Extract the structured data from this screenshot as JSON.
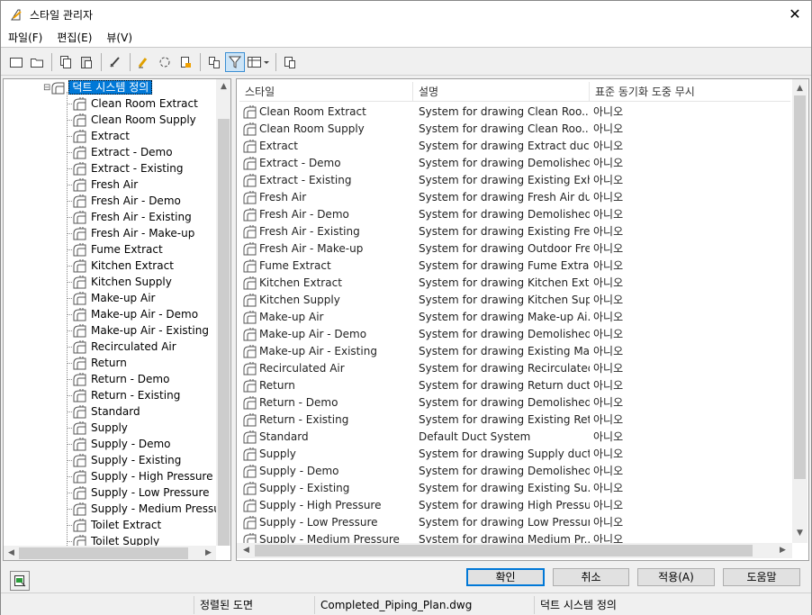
{
  "window": {
    "title": "스타일 관리자",
    "close_label": "✕"
  },
  "menu": [
    {
      "label": "파일(F)"
    },
    {
      "label": "편집(E)"
    },
    {
      "label": "뷰(V)"
    }
  ],
  "toolbar": {
    "active_tool": "filter-icon"
  },
  "tree": {
    "root_label": "덕트 시스템 정의",
    "items": [
      "Clean Room Extract",
      "Clean Room Supply",
      "Extract",
      "Extract - Demo",
      "Extract - Existing",
      "Fresh Air",
      "Fresh Air - Demo",
      "Fresh Air - Existing",
      "Fresh Air - Make-up",
      "Fume Extract",
      "Kitchen Extract",
      "Kitchen Supply",
      "Make-up Air",
      "Make-up Air - Demo",
      "Make-up Air - Existing",
      "Recirculated Air",
      "Return",
      "Return - Demo",
      "Return - Existing",
      "Standard",
      "Supply",
      "Supply - Demo",
      "Supply - Existing",
      "Supply - High Pressure",
      "Supply - Low Pressure",
      "Supply - Medium Pressu",
      "Toilet Extract",
      "Toilet Supply"
    ]
  },
  "list": {
    "columns": [
      "스타일",
      "설명",
      "표준 동기화 도중 무시"
    ],
    "rows": [
      {
        "style": "Clean Room Extract",
        "desc": "System for drawing Clean Roo...",
        "ignore": "아니오"
      },
      {
        "style": "Clean Room Supply",
        "desc": "System for drawing Clean Roo...",
        "ignore": "아니오"
      },
      {
        "style": "Extract",
        "desc": "System for drawing Extract duct.",
        "ignore": "아니오"
      },
      {
        "style": "Extract - Demo",
        "desc": "System for drawing Demolished...",
        "ignore": "아니오"
      },
      {
        "style": "Extract - Existing",
        "desc": "System for drawing Existing Exh...",
        "ignore": "아니오"
      },
      {
        "style": "Fresh Air",
        "desc": "System for drawing Fresh Air du...",
        "ignore": "아니오"
      },
      {
        "style": "Fresh Air - Demo",
        "desc": "System for drawing Demolished...",
        "ignore": "아니오"
      },
      {
        "style": "Fresh Air - Existing",
        "desc": "System for drawing Existing Fre...",
        "ignore": "아니오"
      },
      {
        "style": "Fresh Air - Make-up",
        "desc": "System for drawing Outdoor Fre...",
        "ignore": "아니오"
      },
      {
        "style": "Fume Extract",
        "desc": "System for drawing Fume Extra...",
        "ignore": "아니오"
      },
      {
        "style": "Kitchen Extract",
        "desc": "System for drawing Kitchen Extr...",
        "ignore": "아니오"
      },
      {
        "style": "Kitchen Supply",
        "desc": "System for drawing Kitchen Sup...",
        "ignore": "아니오"
      },
      {
        "style": "Make-up Air",
        "desc": "System for drawing Make-up Ai...",
        "ignore": "아니오"
      },
      {
        "style": "Make-up Air - Demo",
        "desc": "System for drawing Demolished...",
        "ignore": "아니오"
      },
      {
        "style": "Make-up Air - Existing",
        "desc": "System for drawing Existing Ma...",
        "ignore": "아니오"
      },
      {
        "style": "Recirculated Air",
        "desc": "System for drawing Recirculated...",
        "ignore": "아니오"
      },
      {
        "style": "Return",
        "desc": "System for drawing Return duct.",
        "ignore": "아니오"
      },
      {
        "style": "Return - Demo",
        "desc": "System for drawing Demolished...",
        "ignore": "아니오"
      },
      {
        "style": "Return - Existing",
        "desc": "System for drawing Existing Ret...",
        "ignore": "아니오"
      },
      {
        "style": "Standard",
        "desc": "Default Duct System",
        "ignore": "아니오"
      },
      {
        "style": "Supply",
        "desc": "System for drawing Supply duct.",
        "ignore": "아니오"
      },
      {
        "style": "Supply - Demo",
        "desc": "System for drawing Demolished...",
        "ignore": "아니오"
      },
      {
        "style": "Supply - Existing",
        "desc": "System for drawing Existing Su...",
        "ignore": "아니오"
      },
      {
        "style": "Supply - High Pressure",
        "desc": "System for drawing High Pressu...",
        "ignore": "아니오"
      },
      {
        "style": "Supply - Low Pressure",
        "desc": "System for drawing Low Pressur...",
        "ignore": "아니오"
      },
      {
        "style": "Supply - Medium Pressure",
        "desc": "System for drawing Medium Pr...",
        "ignore": "아니오"
      }
    ]
  },
  "buttons": {
    "ok": "확인",
    "cancel": "취소",
    "apply": "적용(A)",
    "help": "도움말"
  },
  "status": {
    "cell1": "정렬된 도면",
    "cell2": "Completed_Piping_Plan.dwg",
    "cell3": "덕트 시스템 정의"
  },
  "colors": {
    "selection": "#0078d7",
    "active_tool": "#cce4f7"
  }
}
